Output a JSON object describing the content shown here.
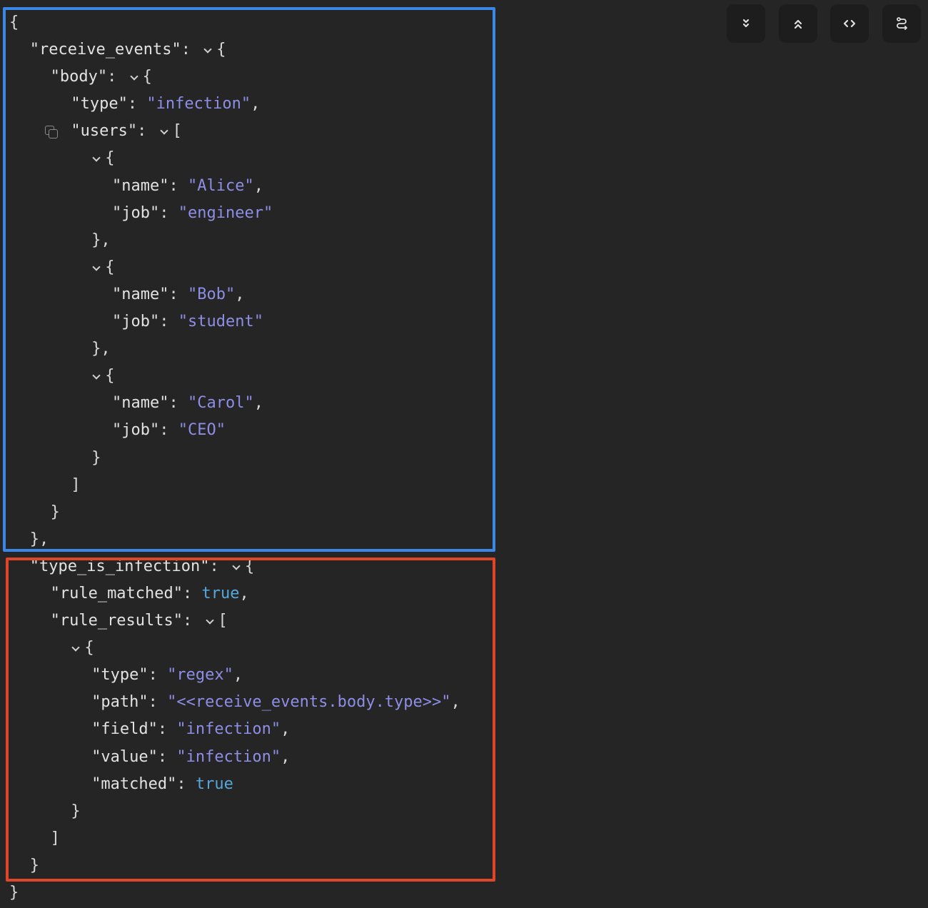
{
  "toolbar": {
    "buttons": [
      {
        "name": "expand-all-button",
        "icon": "chevrons-down-icon"
      },
      {
        "name": "collapse-all-button",
        "icon": "chevrons-up-icon"
      },
      {
        "name": "raw-code-button",
        "icon": "code-icon"
      },
      {
        "name": "route-view-button",
        "icon": "route-icon"
      }
    ]
  },
  "colors": {
    "key": "#e2e2e2",
    "string": "#8e8ee6",
    "boolean": "#56a8dc",
    "highlight_blue": "#3b87e8",
    "highlight_red": "#e0452a"
  },
  "lines": [
    {
      "indent": 0,
      "open": "{"
    },
    {
      "indent": 1,
      "key": "\"receive_events\"",
      "toggle": true,
      "open": "{"
    },
    {
      "indent": 2,
      "key": "\"body\"",
      "toggle": true,
      "open": "{"
    },
    {
      "indent": 3,
      "key": "\"type\"",
      "value": "\"infection\"",
      "vtype": "str",
      "comma": true
    },
    {
      "indent": 3,
      "key": "\"users\"",
      "toggle": true,
      "open": "[",
      "copy": true
    },
    {
      "indent": 4,
      "toggle": true,
      "open": "{"
    },
    {
      "indent": 5,
      "key": "\"name\"",
      "value": "\"Alice\"",
      "vtype": "str",
      "comma": true
    },
    {
      "indent": 5,
      "key": "\"job\"",
      "value": "\"engineer\"",
      "vtype": "str"
    },
    {
      "indent": 4,
      "open": "},"
    },
    {
      "indent": 4,
      "toggle": true,
      "open": "{"
    },
    {
      "indent": 5,
      "key": "\"name\"",
      "value": "\"Bob\"",
      "vtype": "str",
      "comma": true
    },
    {
      "indent": 5,
      "key": "\"job\"",
      "value": "\"student\"",
      "vtype": "str"
    },
    {
      "indent": 4,
      "open": "},"
    },
    {
      "indent": 4,
      "toggle": true,
      "open": "{"
    },
    {
      "indent": 5,
      "key": "\"name\"",
      "value": "\"Carol\"",
      "vtype": "str",
      "comma": true
    },
    {
      "indent": 5,
      "key": "\"job\"",
      "value": "\"CEO\"",
      "vtype": "str"
    },
    {
      "indent": 4,
      "open": "}"
    },
    {
      "indent": 3,
      "open": "]"
    },
    {
      "indent": 2,
      "open": "}"
    },
    {
      "indent": 1,
      "open": "},"
    },
    {
      "indent": 1,
      "key": "\"type_is_infection\"",
      "toggle": true,
      "open": "{"
    },
    {
      "indent": 2,
      "key": "\"rule_matched\"",
      "value": "true",
      "vtype": "bool",
      "comma": true
    },
    {
      "indent": 2,
      "key": "\"rule_results\"",
      "toggle": true,
      "open": "["
    },
    {
      "indent": 3,
      "toggle": true,
      "open": "{"
    },
    {
      "indent": 4,
      "key": "\"type\"",
      "value": "\"regex\"",
      "vtype": "str",
      "comma": true
    },
    {
      "indent": 4,
      "key": "\"path\"",
      "value": "\"<<receive_events.body.type>>\"",
      "vtype": "str",
      "comma": true
    },
    {
      "indent": 4,
      "key": "\"field\"",
      "value": "\"infection\"",
      "vtype": "str",
      "comma": true
    },
    {
      "indent": 4,
      "key": "\"value\"",
      "value": "\"infection\"",
      "vtype": "str",
      "comma": true
    },
    {
      "indent": 4,
      "key": "\"matched\"",
      "value": "true",
      "vtype": "bool"
    },
    {
      "indent": 3,
      "open": "}"
    },
    {
      "indent": 2,
      "open": "]"
    },
    {
      "indent": 1,
      "open": "}"
    },
    {
      "indent": 0,
      "open": "}"
    }
  ]
}
